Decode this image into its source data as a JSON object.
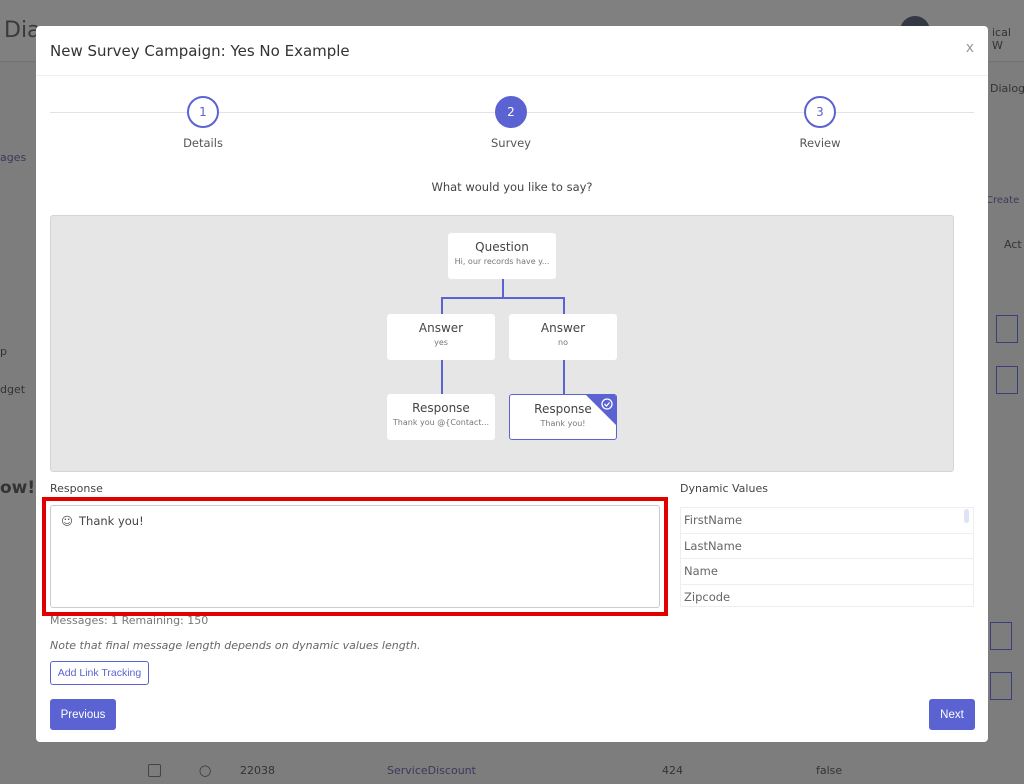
{
  "background": {
    "app_title_partial": "Dia",
    "user_partial": "ical W",
    "sidebar_partials": [
      "ages",
      "p",
      "dget",
      "ow!"
    ],
    "right_partials": [
      "Dialog",
      "Create",
      "Act"
    ],
    "bottom_row": {
      "id": "22038",
      "name": "ServiceDiscount",
      "count": "424",
      "flag": "false"
    }
  },
  "modal": {
    "title": "New Survey Campaign: Yes No Example",
    "close_label": "x",
    "steps": [
      {
        "number": "1",
        "label": "Details",
        "active": false
      },
      {
        "number": "2",
        "label": "Survey",
        "active": true
      },
      {
        "number": "3",
        "label": "Review",
        "active": false
      }
    ],
    "prompt": "What would you like to say?",
    "flow": {
      "question": {
        "title": "Question",
        "subtitle": "Hi, our records have y..."
      },
      "answers": [
        {
          "title": "Answer",
          "subtitle": "yes"
        },
        {
          "title": "Answer",
          "subtitle": "no"
        }
      ],
      "responses": [
        {
          "title": "Response",
          "subtitle": "Thank you @{Contact...",
          "selected": false
        },
        {
          "title": "Response",
          "subtitle": "Thank you!",
          "selected": true
        }
      ]
    },
    "response_label": "Response",
    "response_value": "Thank you!",
    "messages_info": "Messages: 1 Remaining: 150",
    "note": "Note that final message length depends on dynamic values length.",
    "add_link_tracking": "Add Link Tracking",
    "dynamic_values_label": "Dynamic Values",
    "dynamic_values": [
      "FirstName",
      "LastName",
      "Name",
      "Zipcode"
    ],
    "previous_label": "Previous",
    "next_label": "Next"
  },
  "colors": {
    "accent": "#5b63d3",
    "highlight": "#e00000"
  }
}
